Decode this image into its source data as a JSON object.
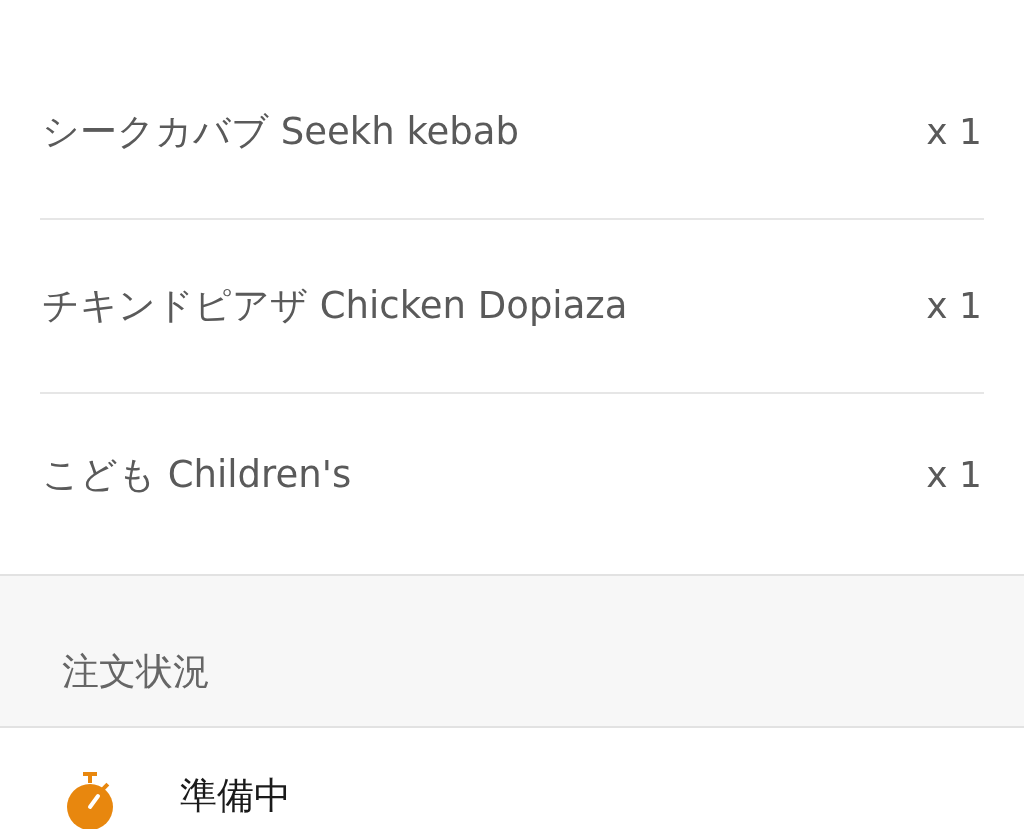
{
  "order_items": [
    {
      "name": "シークカバブ Seekh kebab",
      "quantity": "x 1"
    },
    {
      "name": "チキンドピアザ Chicken Dopiaza",
      "quantity": "x 1"
    },
    {
      "name": "こども Children's",
      "quantity": "x 1"
    }
  ],
  "status_section": {
    "heading": "注文状況"
  },
  "status_steps": [
    {
      "label": "準備中"
    }
  ]
}
